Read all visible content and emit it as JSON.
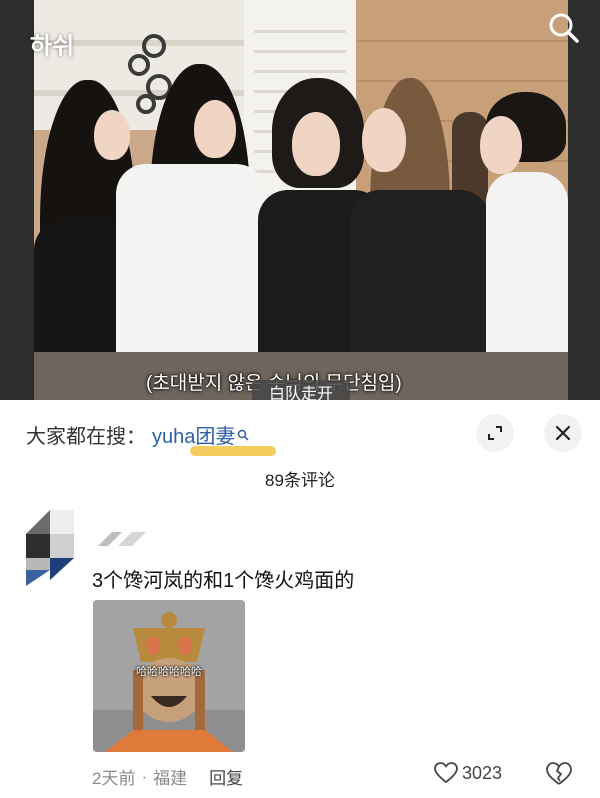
{
  "video": {
    "watermark": "하쉬",
    "subtitle": "(초대받지 않은 손님의 무단침입)",
    "overlay_text": "白队走开",
    "search_icon": "search-icon"
  },
  "sheet": {
    "search_prefix": "大家都在搜：",
    "search_term": "yuha团妻",
    "comment_count": "89条评论",
    "collapse_icon": "collapse-icon",
    "close_icon": "close-icon"
  },
  "comment": {
    "text": "3个馋河岚的和1个馋火鸡面的",
    "sticker_caption": "哈哈哈哈哈哈",
    "time": "2天前",
    "location": "福建",
    "reply_label": "回复",
    "likes": "3023"
  },
  "colors": {
    "link": "#2f5ea8",
    "highlight": "#f2c94c",
    "meta": "#8a8a8a"
  }
}
